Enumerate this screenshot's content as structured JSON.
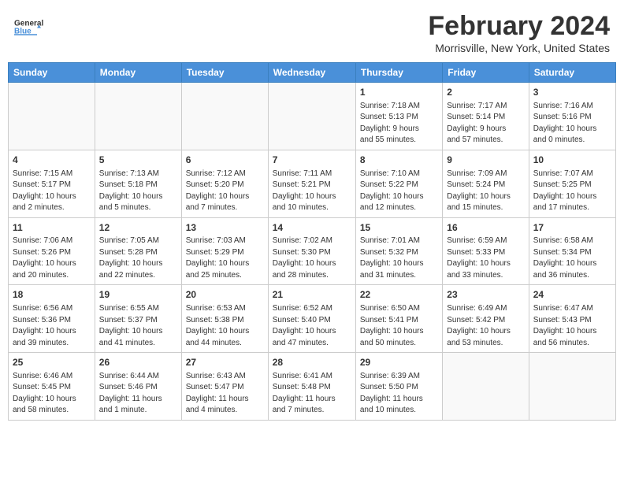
{
  "header": {
    "logo_line1": "General",
    "logo_line2": "Blue",
    "month": "February 2024",
    "location": "Morrisville, New York, United States"
  },
  "weekdays": [
    "Sunday",
    "Monday",
    "Tuesday",
    "Wednesday",
    "Thursday",
    "Friday",
    "Saturday"
  ],
  "weeks": [
    [
      {
        "day": "",
        "info": ""
      },
      {
        "day": "",
        "info": ""
      },
      {
        "day": "",
        "info": ""
      },
      {
        "day": "",
        "info": ""
      },
      {
        "day": "1",
        "info": "Sunrise: 7:18 AM\nSunset: 5:13 PM\nDaylight: 9 hours\nand 55 minutes."
      },
      {
        "day": "2",
        "info": "Sunrise: 7:17 AM\nSunset: 5:14 PM\nDaylight: 9 hours\nand 57 minutes."
      },
      {
        "day": "3",
        "info": "Sunrise: 7:16 AM\nSunset: 5:16 PM\nDaylight: 10 hours\nand 0 minutes."
      }
    ],
    [
      {
        "day": "4",
        "info": "Sunrise: 7:15 AM\nSunset: 5:17 PM\nDaylight: 10 hours\nand 2 minutes."
      },
      {
        "day": "5",
        "info": "Sunrise: 7:13 AM\nSunset: 5:18 PM\nDaylight: 10 hours\nand 5 minutes."
      },
      {
        "day": "6",
        "info": "Sunrise: 7:12 AM\nSunset: 5:20 PM\nDaylight: 10 hours\nand 7 minutes."
      },
      {
        "day": "7",
        "info": "Sunrise: 7:11 AM\nSunset: 5:21 PM\nDaylight: 10 hours\nand 10 minutes."
      },
      {
        "day": "8",
        "info": "Sunrise: 7:10 AM\nSunset: 5:22 PM\nDaylight: 10 hours\nand 12 minutes."
      },
      {
        "day": "9",
        "info": "Sunrise: 7:09 AM\nSunset: 5:24 PM\nDaylight: 10 hours\nand 15 minutes."
      },
      {
        "day": "10",
        "info": "Sunrise: 7:07 AM\nSunset: 5:25 PM\nDaylight: 10 hours\nand 17 minutes."
      }
    ],
    [
      {
        "day": "11",
        "info": "Sunrise: 7:06 AM\nSunset: 5:26 PM\nDaylight: 10 hours\nand 20 minutes."
      },
      {
        "day": "12",
        "info": "Sunrise: 7:05 AM\nSunset: 5:28 PM\nDaylight: 10 hours\nand 22 minutes."
      },
      {
        "day": "13",
        "info": "Sunrise: 7:03 AM\nSunset: 5:29 PM\nDaylight: 10 hours\nand 25 minutes."
      },
      {
        "day": "14",
        "info": "Sunrise: 7:02 AM\nSunset: 5:30 PM\nDaylight: 10 hours\nand 28 minutes."
      },
      {
        "day": "15",
        "info": "Sunrise: 7:01 AM\nSunset: 5:32 PM\nDaylight: 10 hours\nand 31 minutes."
      },
      {
        "day": "16",
        "info": "Sunrise: 6:59 AM\nSunset: 5:33 PM\nDaylight: 10 hours\nand 33 minutes."
      },
      {
        "day": "17",
        "info": "Sunrise: 6:58 AM\nSunset: 5:34 PM\nDaylight: 10 hours\nand 36 minutes."
      }
    ],
    [
      {
        "day": "18",
        "info": "Sunrise: 6:56 AM\nSunset: 5:36 PM\nDaylight: 10 hours\nand 39 minutes."
      },
      {
        "day": "19",
        "info": "Sunrise: 6:55 AM\nSunset: 5:37 PM\nDaylight: 10 hours\nand 41 minutes."
      },
      {
        "day": "20",
        "info": "Sunrise: 6:53 AM\nSunset: 5:38 PM\nDaylight: 10 hours\nand 44 minutes."
      },
      {
        "day": "21",
        "info": "Sunrise: 6:52 AM\nSunset: 5:40 PM\nDaylight: 10 hours\nand 47 minutes."
      },
      {
        "day": "22",
        "info": "Sunrise: 6:50 AM\nSunset: 5:41 PM\nDaylight: 10 hours\nand 50 minutes."
      },
      {
        "day": "23",
        "info": "Sunrise: 6:49 AM\nSunset: 5:42 PM\nDaylight: 10 hours\nand 53 minutes."
      },
      {
        "day": "24",
        "info": "Sunrise: 6:47 AM\nSunset: 5:43 PM\nDaylight: 10 hours\nand 56 minutes."
      }
    ],
    [
      {
        "day": "25",
        "info": "Sunrise: 6:46 AM\nSunset: 5:45 PM\nDaylight: 10 hours\nand 58 minutes."
      },
      {
        "day": "26",
        "info": "Sunrise: 6:44 AM\nSunset: 5:46 PM\nDaylight: 11 hours\nand 1 minute."
      },
      {
        "day": "27",
        "info": "Sunrise: 6:43 AM\nSunset: 5:47 PM\nDaylight: 11 hours\nand 4 minutes."
      },
      {
        "day": "28",
        "info": "Sunrise: 6:41 AM\nSunset: 5:48 PM\nDaylight: 11 hours\nand 7 minutes."
      },
      {
        "day": "29",
        "info": "Sunrise: 6:39 AM\nSunset: 5:50 PM\nDaylight: 11 hours\nand 10 minutes."
      },
      {
        "day": "",
        "info": ""
      },
      {
        "day": "",
        "info": ""
      }
    ]
  ]
}
